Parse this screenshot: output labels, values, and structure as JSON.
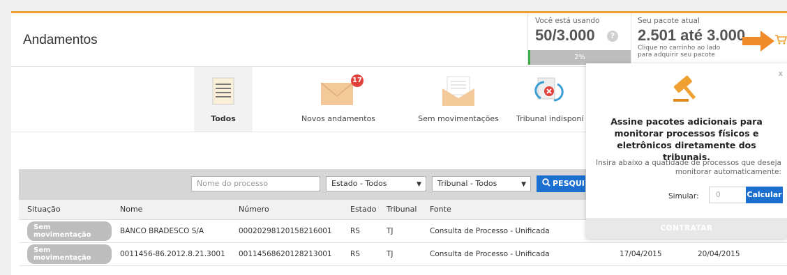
{
  "header": {
    "title": "Andamentos"
  },
  "usage": {
    "label": "Você está usando",
    "value": "50/3.000",
    "help_icon": "?",
    "progress_fraction": 0.02,
    "progress_label": "2%"
  },
  "package": {
    "label": "Seu pacote atual",
    "value": "2.501 até 3.000",
    "hint": "Clique no carrinho ao lado para adquirir seu pacote"
  },
  "tabs": [
    {
      "label": "Todos",
      "icon": "list-document-icon",
      "active": true
    },
    {
      "label": "Novos andamentos",
      "icon": "envelope-icon",
      "badge": "17"
    },
    {
      "label": "Sem movimentações",
      "icon": "open-envelope-icon"
    },
    {
      "label": "Tribunal indisponí",
      "icon": "refresh-error-icon"
    }
  ],
  "filters": {
    "name_placeholder": "Nome do processo",
    "estado": "Estado - Todos",
    "tribunal": "Tribunal - Todos",
    "search_label": "PESQUI"
  },
  "table": {
    "headers": [
      "Situação",
      "Nome",
      "Número",
      "Estado",
      "Tribunal",
      "Fonte",
      "",
      ""
    ],
    "rows": [
      {
        "situacao": "Sem movimentação",
        "nome": "BANCO BRADESCO S/A",
        "numero": "00020298120158216001",
        "estado": "RS",
        "tribunal": "TJ",
        "fonte": "Consulta de Processo - Unificada",
        "d1": "",
        "d2": ""
      },
      {
        "situacao": "Sem movimentação",
        "nome": "0011456-86.2012.8.21.3001",
        "numero": "00114568620128213001",
        "estado": "RS",
        "tribunal": "TJ",
        "fonte": "Consulta de Processo - Unificada",
        "d1": "17/04/2015",
        "d2": "20/04/2015"
      }
    ]
  },
  "popup": {
    "close": "x",
    "heading": "Assine pacotes adicionais para monitorar processos físicos e eletrônicos diretamente dos tribunais.",
    "description": "Insira abaixo a quatidade de processos que deseja monitorar automaticamente:",
    "simulate_label": "Simular:",
    "simulate_placeholder": "0",
    "calc_label": "Calcular",
    "contract_label": "CONTRATAR"
  },
  "colors": {
    "accent": "#f0a030",
    "primary": "#1a6fd0",
    "progress": "#3cb043",
    "badge": "#e0413b"
  }
}
